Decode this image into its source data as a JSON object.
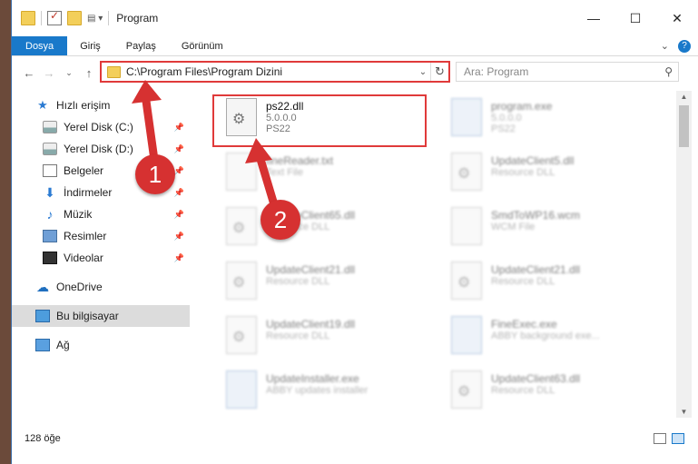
{
  "window": {
    "title": "Program",
    "controls": {
      "minimize": "—",
      "maximize": "☐",
      "close": "✕"
    }
  },
  "ribbon": {
    "tabs": [
      "Dosya",
      "Giriş",
      "Paylaş",
      "Görünüm"
    ],
    "expand": "⌄",
    "help": "?"
  },
  "address": {
    "path": "C:\\Program Files\\Program Dizini",
    "dropdown": "⌄",
    "refresh": "↻"
  },
  "search": {
    "placeholder": "Ara: Program",
    "icon": "search-icon"
  },
  "nav_buttons": {
    "back": "←",
    "forward": "→",
    "recent": "⌄",
    "up": "↑"
  },
  "sidebar": {
    "items": [
      {
        "label": "Hızlı erişim",
        "icon": "star-icon"
      },
      {
        "label": "Yerel Disk (C:)",
        "icon": "drive-icon",
        "pinned": true
      },
      {
        "label": "Yerel Disk (D:)",
        "icon": "drive-icon",
        "pinned": true
      },
      {
        "label": "Belgeler",
        "icon": "documents-icon",
        "pinned": true
      },
      {
        "label": "İndirmeler",
        "icon": "download-icon",
        "pinned": true
      },
      {
        "label": "Müzik",
        "icon": "music-icon",
        "pinned": true
      },
      {
        "label": "Resimler",
        "icon": "pictures-icon",
        "pinned": true
      },
      {
        "label": "Videolar",
        "icon": "videos-icon",
        "pinned": true
      },
      {
        "label": "OneDrive",
        "icon": "cloud-icon"
      },
      {
        "label": "Bu bilgisayar",
        "icon": "computer-icon",
        "selected": true
      },
      {
        "label": "Ağ",
        "icon": "network-icon"
      }
    ]
  },
  "files": [
    {
      "name": "ps22.dll",
      "line1": "5.0.0.0",
      "line2": "PS22",
      "highlighted": true
    },
    {
      "name": "program.exe",
      "line1": "5.0.0.0",
      "line2": "PS22"
    },
    {
      "name": "fineReader.txt",
      "line1": "Text File",
      "line2": ""
    },
    {
      "name": "UpdateClient5.dll",
      "line1": "Resource DLL",
      "line2": ""
    },
    {
      "name": "UpdateClient65.dll",
      "line1": "Resource DLL",
      "line2": ""
    },
    {
      "name": "SmdToWP16.wcm",
      "line1": "WCM File",
      "line2": ""
    },
    {
      "name": "UpdateClient21.dll",
      "line1": "Resource DLL",
      "line2": ""
    },
    {
      "name": "UpdateClient21.dll",
      "line1": "Resource DLL",
      "line2": ""
    },
    {
      "name": "UpdateClient19.dll",
      "line1": "Resource DLL",
      "line2": ""
    },
    {
      "name": "FineExec.exe",
      "line1": "ABBY background exe...",
      "line2": ""
    },
    {
      "name": "UpdateInstaller.exe",
      "line1": "ABBY updates installer",
      "line2": ""
    },
    {
      "name": "UpdateClient63.dll",
      "line1": "Resource DLL",
      "line2": ""
    }
  ],
  "status": {
    "count": "128 öğe"
  },
  "callouts": [
    "1",
    "2"
  ]
}
